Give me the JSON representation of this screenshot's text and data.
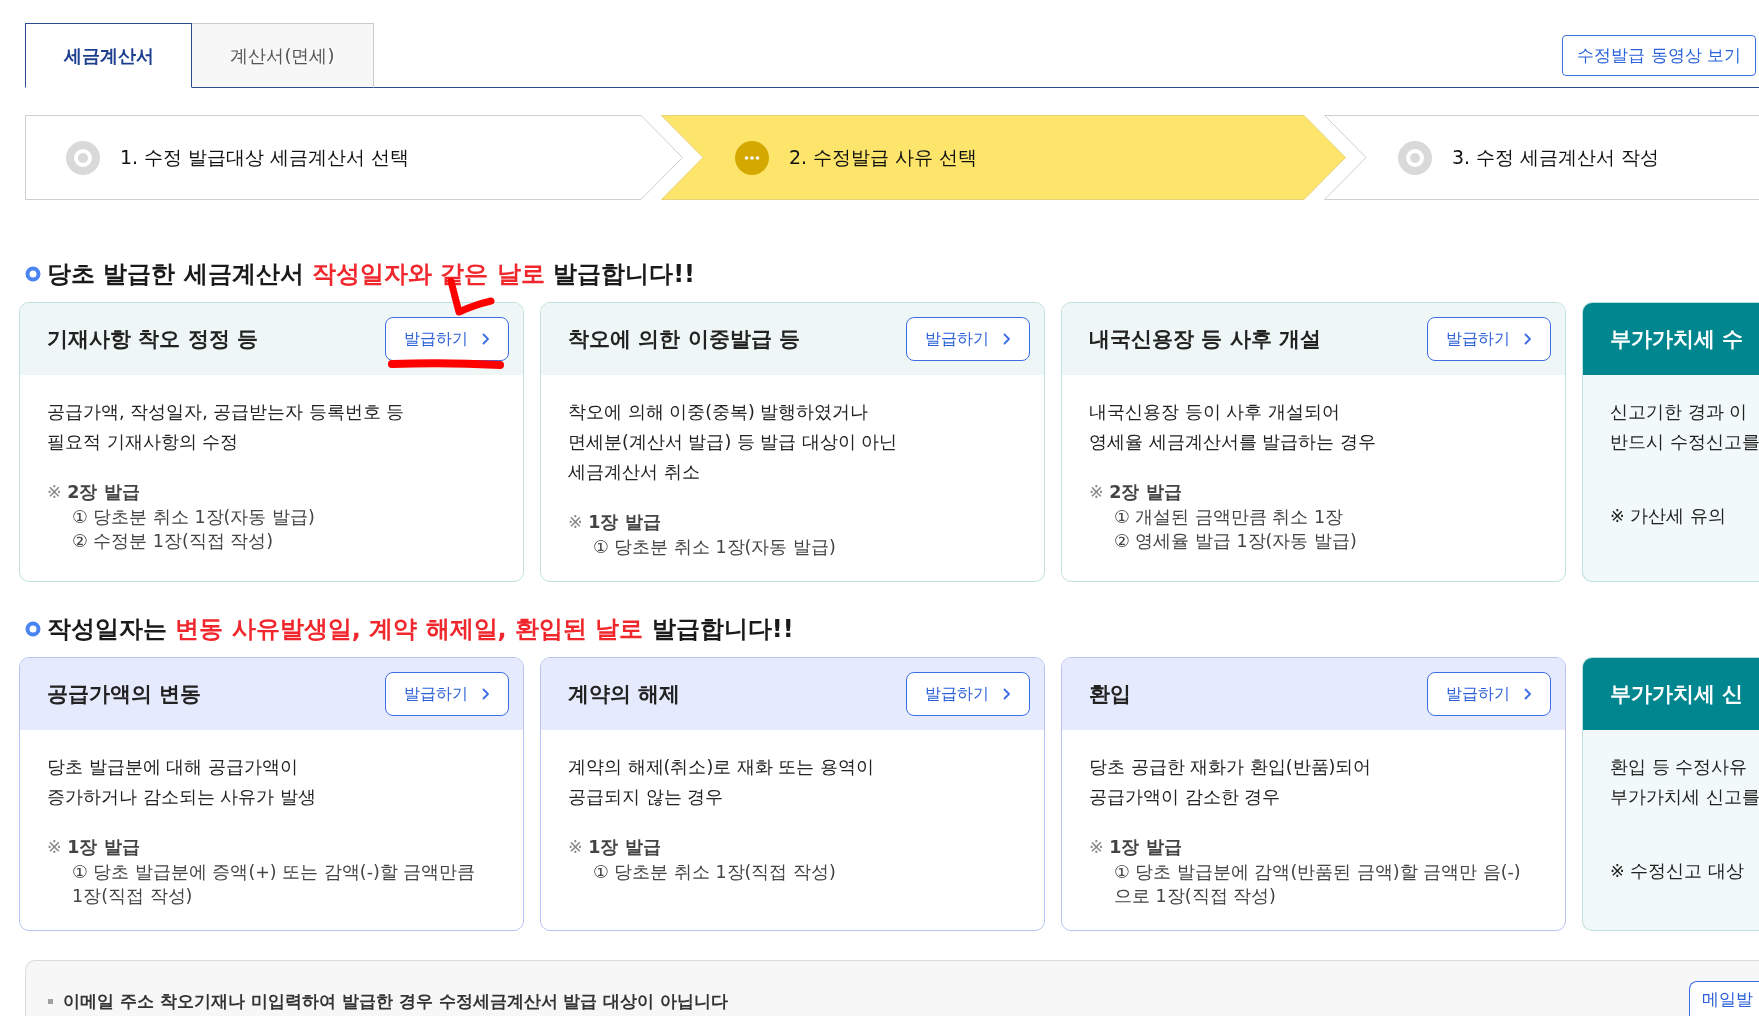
{
  "tabs": [
    {
      "label": "세금계산서",
      "selected": true
    },
    {
      "label": "계산서(면세)",
      "selected": false
    }
  ],
  "video_button": "수정발급 동영상 보기",
  "steps": [
    {
      "label": "1. 수정 발급대상 세금계산서 선택",
      "selected": false
    },
    {
      "label": "2. 수정발급 사유 선택",
      "selected": true
    },
    {
      "label": "3. 수정 세금계산서 작성",
      "selected": false
    }
  ],
  "sections": [
    {
      "kind": "correction",
      "heading": [
        {
          "kind": "plain",
          "text": "당초 발급한 세금계산서 "
        },
        {
          "kind": "highlight",
          "text": "작성일자와 같은 날로"
        },
        {
          "kind": "plain",
          "text": " 발급합니다!!"
        }
      ],
      "cards": [
        {
          "kind": "action",
          "title": "기재사항 착오 정정 등",
          "button": "발급하기",
          "description": [
            "공급가액, 작성일자, 공급받는자 등록번호 등",
            "필요적 기재사항의 수정"
          ],
          "note": "※ **2장 발급**",
          "note_items": [
            "① 당초분 취소 1장(자동 발급)",
            "② 수정분 1장(직접 작성)"
          ]
        },
        {
          "kind": "action",
          "title": "착오에 의한 이중발급 등",
          "button": "발급하기",
          "description": [
            "착오에 의해 이중(중복) 발행하였거나",
            "면세분(계산서 발급) 등 발급 대상이 아닌",
            "세금계산서 취소"
          ],
          "note": "※ **1장 발급**",
          "note_items": [
            "① 당초분 취소 1장(자동 발급)"
          ]
        },
        {
          "kind": "action",
          "title": "내국신용장 등 사후 개설",
          "button": "발급하기",
          "description": [
            "내국신용장 등이 사후 개설되어",
            "영세율 세금계산서를 발급하는 경우"
          ],
          "note": "※ **2장 발급**",
          "note_items": [
            "① 개설된 금액만큼 취소 1장",
            "② 영세율 발급 1장(자동 발급)"
          ]
        },
        {
          "kind": "guide",
          "title": "부가가치세 수",
          "description": [
            "신고기한 경과 이",
            "반드시 수정신고를"
          ],
          "note": "※ 가산세 유의"
        }
      ]
    },
    {
      "kind": "change",
      "heading": [
        {
          "kind": "plain",
          "text": "작성일자는 "
        },
        {
          "kind": "highlight",
          "text": "변동 사유발생일, 계약 해제일, 환입된 날로"
        },
        {
          "kind": "plain",
          "text": " 발급합니다!!"
        }
      ],
      "cards": [
        {
          "kind": "action",
          "title": "공급가액의 변동",
          "button": "발급하기",
          "description": [
            "당초 발급분에 대해 공급가액이",
            "증가하거나 감소되는 사유가 발생"
          ],
          "note": "※ **1장 발급**",
          "note_items": [
            "① 당초 발급분에 증액(+) 또는 감액(-)할 금액만큼 1장(직접 작성)"
          ]
        },
        {
          "kind": "action",
          "title": "계약의 해제",
          "button": "발급하기",
          "description": [
            "계약의 해제(취소)로 재화 또는 용역이",
            "공급되지 않는 경우"
          ],
          "note": "※ **1장 발급**",
          "note_items": [
            "① 당초분 취소 1장(직접 작성)"
          ]
        },
        {
          "kind": "action",
          "title": "환입",
          "button": "발급하기",
          "description": [
            "당초 공급한 재화가 환입(반품)되어",
            "공급가액이 감소한 경우"
          ],
          "note": "※ **1장 발급**",
          "note_items": [
            "① 당초 발급분에 감액(반품된 금액)할 금액만 음(-)으로 1장(직접 작성)"
          ]
        },
        {
          "kind": "guide",
          "title": "부가가치세 신",
          "description": [
            "환입 등 수정사유",
            "부가가치세 신고를"
          ],
          "note": "※ 수정신고 대상"
        }
      ]
    }
  ],
  "notice": {
    "text": "이메일 주소 착오기재나 미입력하여 발급한 경우 수정세금계산서 발급 대상이 아닙니다",
    "button": "메일발"
  },
  "annotations": [
    {
      "kind": "checkmark"
    },
    {
      "kind": "underline"
    }
  ]
}
